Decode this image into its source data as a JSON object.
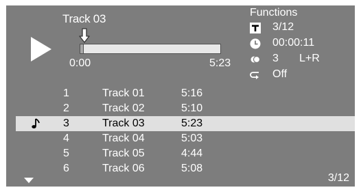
{
  "now_playing": {
    "title": "Track 03",
    "elapsed_label": "0:00",
    "duration_label": "5:23",
    "progress_fraction": 0.02
  },
  "functions": {
    "title": "Functions",
    "track": {
      "icon": "track-number-icon",
      "value": "3/12"
    },
    "time": {
      "icon": "clock-icon",
      "value": "00:00:11"
    },
    "audio": {
      "icon": "audio-icon",
      "value": "3",
      "extra": "L+R"
    },
    "repeat": {
      "icon": "repeat-icon",
      "value": "Off"
    }
  },
  "playlist": {
    "selected_index": 2,
    "rows": [
      {
        "num": "1",
        "name": "Track 01",
        "time": "5:16"
      },
      {
        "num": "2",
        "name": "Track 02",
        "time": "5:10"
      },
      {
        "num": "3",
        "name": "Track 03",
        "time": "5:23"
      },
      {
        "num": "4",
        "name": "Track 04",
        "time": "5:03"
      },
      {
        "num": "5",
        "name": "Track 05",
        "time": "4:44"
      },
      {
        "num": "6",
        "name": "Track 06",
        "time": "5:08"
      }
    ]
  },
  "page_indicator": "3/12",
  "icons": {
    "play": "play-icon",
    "position": "position-arrow-icon",
    "playing": "music-note-icon",
    "more": "scroll-down-arrow-icon"
  },
  "colors": {
    "background": "#7d7d7d",
    "text": "#ffffff",
    "highlight": "#e0e0e0",
    "highlight_text": "#000000"
  }
}
